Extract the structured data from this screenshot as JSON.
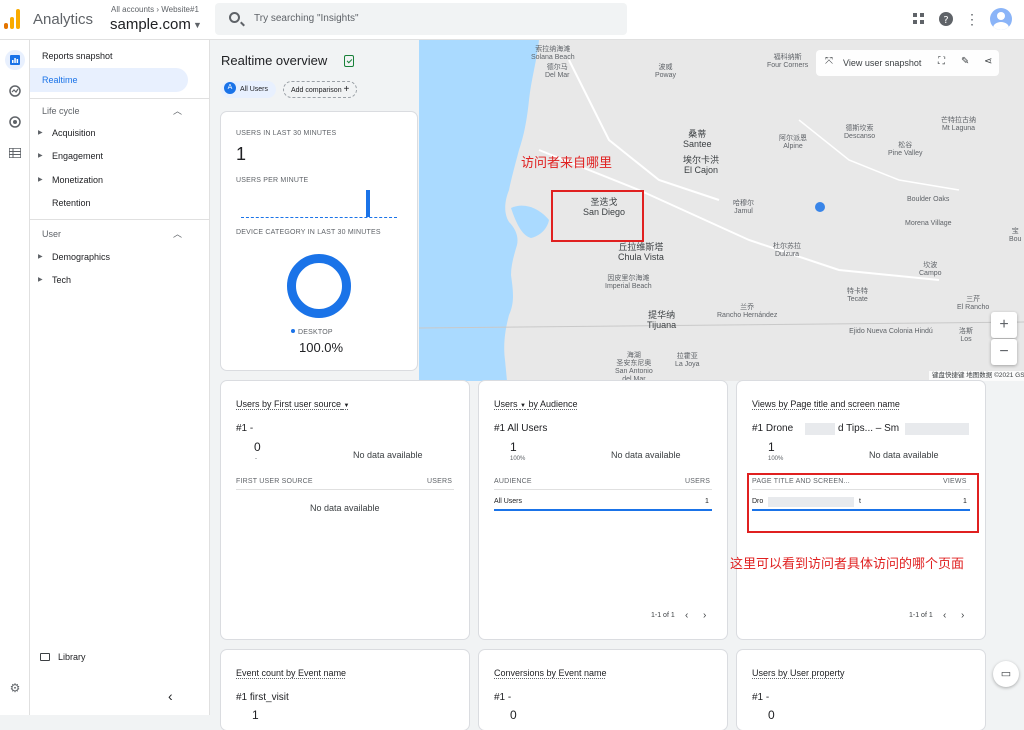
{
  "header": {
    "app_name": "Analytics",
    "breadcrumb": "All accounts › Website#1",
    "property": "sample.com",
    "search_placeholder": "Try searching \"Insights\""
  },
  "icons": {
    "apps": "apps-grid-icon",
    "help": "help-icon",
    "more": "more-vert-icon",
    "account": "account-avatar"
  },
  "colors": {
    "brand_orange": "#f9ab00",
    "accent": "#1a73e8",
    "annotation": "#e02020"
  },
  "sidebar": {
    "reports_snapshot": "Reports snapshot",
    "realtime": "Realtime",
    "lifecycle": {
      "heading": "Life cycle",
      "items": [
        "Acquisition",
        "Engagement",
        "Monetization",
        "Retention"
      ]
    },
    "user": {
      "heading": "User",
      "items": [
        "Demographics",
        "Tech"
      ]
    },
    "library": "Library"
  },
  "page": {
    "title": "Realtime overview",
    "chip_users": "All Users",
    "chip_users_letter": "A",
    "add_comparison": "Add comparison"
  },
  "summary": {
    "users_label": "USERS IN LAST 30 MINUTES",
    "users_value": "1",
    "per_minute_label": "USERS PER MINUTE",
    "device_label": "DEVICE CATEGORY IN LAST 30 MINUTES",
    "device_name": "DESKTOP",
    "device_pct": "100.0%"
  },
  "map": {
    "toolbar_label": "View user snapshot",
    "attribution": "键盘快捷键   地图数据 ©2021 GS(2011)6020 Google, INEGI   使用条款   报告地图错误",
    "zoom_in": "+",
    "zoom_out": "−",
    "places": [
      {
        "zh": "索拉纳海滩",
        "en": "Solana Beach",
        "id": "solana"
      },
      {
        "zh": "德尔马",
        "en": "Del Mar",
        "id": "delmar"
      },
      {
        "zh": "波威",
        "en": "Poway",
        "id": "poway"
      },
      {
        "zh": "福科纳斯",
        "en": "Four Corners",
        "id": "fourcorners"
      },
      {
        "zh": "桑蒂",
        "en": "Santee",
        "id": "santee"
      },
      {
        "zh": "埃尔卡洪",
        "en": "El Cajon",
        "id": "elcajon"
      },
      {
        "zh": "阿尔派恩",
        "en": "Alpine",
        "id": "alpine"
      },
      {
        "zh": "德斯坎索",
        "en": "Descanso",
        "id": "descanso"
      },
      {
        "zh": "松谷",
        "en": "Pine Valley",
        "id": "pinevalley"
      },
      {
        "zh": "芒特拉古纳",
        "en": "Mt Laguna",
        "id": "mtlaguna"
      },
      {
        "zh": "圣迭戈",
        "en": "San Diego",
        "id": "sandiego"
      },
      {
        "zh": "哈穆尔",
        "en": "Jamul",
        "id": "jamul"
      },
      {
        "zh": "丘拉维斯塔",
        "en": "Chula Vista",
        "id": "chulavista"
      },
      {
        "zh": "因皮里尔海滩",
        "en": "Imperial Beach",
        "id": "imperial"
      },
      {
        "zh": "杜尔苏拉",
        "en": "Dulzura",
        "id": "dulzura"
      },
      {
        "zh": "",
        "en": "Boulder Oaks",
        "id": "boulderoaks"
      },
      {
        "zh": "",
        "en": "Morena Village",
        "id": "morena"
      },
      {
        "zh": "坎波",
        "en": "Campo",
        "id": "campo"
      },
      {
        "zh": "特卡特",
        "en": "Tecate",
        "id": "tecate"
      },
      {
        "zh": "提华纳",
        "en": "Tijuana",
        "id": "tijuana"
      },
      {
        "zh": "兰乔",
        "en": "Rancho Hernández",
        "id": "rancho"
      },
      {
        "zh": "三芹",
        "en": "El Rancho",
        "id": "elrancho"
      },
      {
        "zh": "",
        "en": "Ejido Nueva Colonia Hindú",
        "id": "ejido"
      },
      {
        "zh": "洛斯",
        "en": "Los",
        "id": "los"
      },
      {
        "zh": "海湖\n圣安东尼奥\nSan Antonio\ndel Mar",
        "en": "",
        "id": "sanantonio"
      },
      {
        "zh": "拉霍亚",
        "en": "La Joya",
        "id": "lajoya"
      },
      {
        "zh": "宝",
        "en": "Bou",
        "id": "bou"
      }
    ]
  },
  "annotations": {
    "map_note": "访问者来自哪里",
    "page_note": "这里可以看到访问者具体访问的哪个页面"
  },
  "cards": {
    "source": {
      "title": "Users by First user source",
      "rank": "#1  -",
      "value": "0",
      "sub": "-",
      "no_data": "No data available",
      "col1": "FIRST USER SOURCE",
      "col2": "USERS",
      "empty": "No data available"
    },
    "audience": {
      "title_prefix": "Users",
      "title_suffix": "by Audience",
      "rank": "#1  All Users",
      "value": "1",
      "sub": "100%",
      "no_data": "No data available",
      "col1": "AUDIENCE",
      "col2": "USERS",
      "row_name": "All Users",
      "row_value": "1",
      "pager": "1-1 of 1"
    },
    "pages": {
      "title": "Views by Page title and screen name",
      "rank_a": "#1  Drone",
      "rank_b": "d Tips... – Sm",
      "value": "1",
      "sub": "100%",
      "no_data": "No data available",
      "col1": "PAGE TITLE AND SCREEN...",
      "col2": "VIEWS",
      "row_a": "Dro",
      "row_b": "t",
      "row_value": "1",
      "pager": "1-1 of 1"
    },
    "events": {
      "title": "Event count by Event name",
      "rank": "#1  first_visit",
      "value": "1"
    },
    "conversions": {
      "title": "Conversions by Event name",
      "rank": "#1  -",
      "value": "0"
    },
    "property": {
      "title": "Users by User property",
      "rank": "#1  -",
      "value": "0"
    }
  }
}
